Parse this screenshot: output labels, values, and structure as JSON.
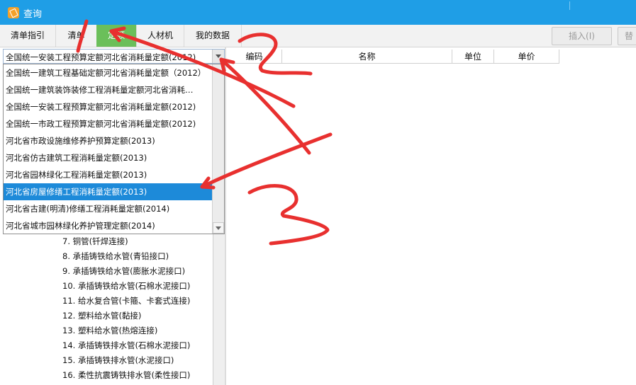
{
  "window": {
    "title": "查询"
  },
  "tabs": [
    {
      "label": "清单指引",
      "active": false
    },
    {
      "label": "清单",
      "active": false
    },
    {
      "label": "定额",
      "active": true
    },
    {
      "label": "人材机",
      "active": false
    },
    {
      "label": "我的数据",
      "active": false
    }
  ],
  "toolbar": {
    "insert_label": "插入(I)",
    "replace_label": "替"
  },
  "combo": {
    "selected_value": "全国统一安装工程预算定额河北省消耗量定额(2012)"
  },
  "dropdown": {
    "selected_index": 7,
    "items": [
      "全国统一建筑工程基础定额河北省消耗量定额（2012）",
      "全国统一建筑装饰装修工程消耗量定额河北省消耗…",
      "全国统一安装工程预算定额河北省消耗量定额(2012)",
      "全国统一市政工程预算定额河北省消耗量定额(2012)",
      "河北省市政设施维修养护预算定额(2013)",
      "河北省仿古建筑工程消耗量定额(2013)",
      "河北省园林绿化工程消耗量定额(2013)",
      "河北省房屋修缮工程消耗量定额(2013)",
      "河北省古建(明清)修缮工程消耗量定额(2014)",
      "河北省城市园林绿化养护管理定额(2014)"
    ]
  },
  "tree": {
    "items": [
      "7.  铜管(钎焊连接)",
      "8.  承插铸铁给水管(青铅接口)",
      "9.  承插铸铁给水管(膨胀水泥接口)",
      "10.  承插铸铁给水管(石棉水泥接口)",
      "11.  给水复合管(卡箍、卡套式连接)",
      "12.  塑料给水管(黏接)",
      "13.  塑料给水管(热熔连接)",
      "14.  承插铸铁排水管(石棉水泥接口)",
      "15.  承插铸铁排水管(水泥接口)",
      "16.  柔性抗震铸铁排水管(柔性接口)"
    ]
  },
  "grid": {
    "columns": [
      "编码",
      "名称",
      "单位",
      "单价"
    ]
  },
  "annotations": {
    "labels": [
      "1",
      "2",
      "3"
    ],
    "color": "#e8302f"
  },
  "colors": {
    "titlebar": "#1f9ee6",
    "active_tab": "#6bbf5a",
    "selection": "#1d8ad9"
  }
}
